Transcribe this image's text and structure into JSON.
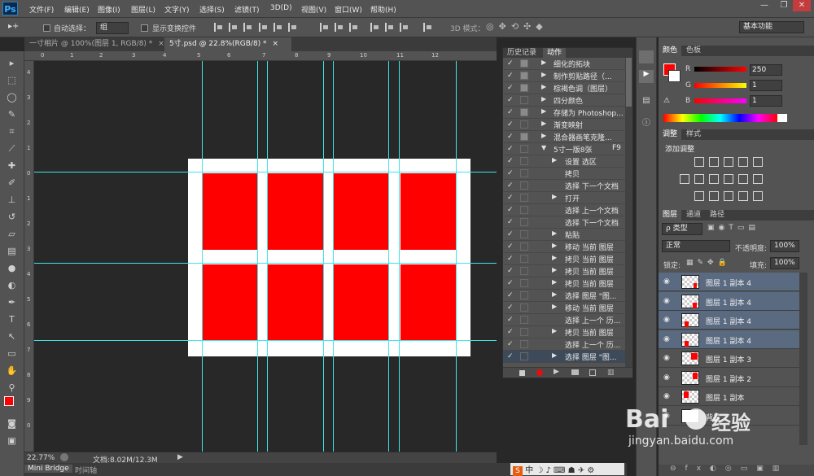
{
  "app": {
    "logo": "Ps",
    "menus": [
      "文件(F)",
      "编辑(E)",
      "图像(I)",
      "图层(L)",
      "文字(Y)",
      "选择(S)",
      "滤镜(T)",
      "3D(D)",
      "视图(V)",
      "窗口(W)",
      "帮助(H)"
    ],
    "win_min": "—",
    "win_max": "❐",
    "win_close": "✕"
  },
  "options": {
    "auto_select_label": "自动选择：",
    "auto_select_value": "组",
    "show_transform_label": "显示变换控件",
    "mode_3d_label": "3D 模式：",
    "workspace": "基本功能"
  },
  "tabs": [
    {
      "label": "一寸相片 @ 100%(图层 1, RGB/8) *",
      "close": "×"
    },
    {
      "label": "5寸.psd @ 22.8%(RGB/8) *",
      "close": "×"
    }
  ],
  "ruler_top": [
    "0",
    "1",
    "2",
    "3",
    "4",
    "5",
    "6",
    "7",
    "8",
    "9",
    "10",
    "11",
    "12"
  ],
  "ruler_left": [
    "4",
    "3",
    "2",
    "1",
    "0",
    "1",
    "2",
    "3",
    "4",
    "5",
    "6",
    "7",
    "8",
    "9",
    "0"
  ],
  "status": {
    "zoom": "22.77%",
    "doc": "文档:8.02M/12.3M"
  },
  "bottom_tabs": [
    "Mini Bridge",
    "时间轴"
  ],
  "actions_panel": {
    "tabs": [
      "历史记录",
      "动作"
    ],
    "rows": [
      {
        "check": "✓",
        "box": true,
        "arrow": "▶",
        "indent": 0,
        "label": "细化的拓块",
        "sel": false
      },
      {
        "check": "✓",
        "box": true,
        "arrow": "▶",
        "indent": 0,
        "label": "制作剪贴路径（...",
        "sel": false
      },
      {
        "check": "✓",
        "box": true,
        "arrow": "▶",
        "indent": 0,
        "label": "棕褐色调（图层）",
        "sel": false
      },
      {
        "check": "✓",
        "box": false,
        "arrow": "▶",
        "indent": 0,
        "label": "四分颜色",
        "sel": false
      },
      {
        "check": "✓",
        "box": true,
        "arrow": "▶",
        "indent": 0,
        "label": "存储为 Photoshop...",
        "sel": false
      },
      {
        "check": "✓",
        "box": false,
        "arrow": "▶",
        "indent": 0,
        "label": "渐变映射",
        "sel": false
      },
      {
        "check": "✓",
        "box": true,
        "arrow": "▶",
        "indent": 0,
        "label": "混合器画笔克隆...",
        "sel": false
      },
      {
        "check": "✓",
        "box": false,
        "arrow": "▼",
        "indent": 0,
        "label": "5寸一版8张",
        "shortcut": "F9",
        "sel": false
      },
      {
        "check": "✓",
        "box": false,
        "arrow": "▶",
        "indent": 1,
        "label": "设置 选区",
        "sel": false
      },
      {
        "check": "✓",
        "box": false,
        "arrow": "",
        "indent": 1,
        "label": "拷贝",
        "sel": false
      },
      {
        "check": "✓",
        "box": false,
        "arrow": "",
        "indent": 1,
        "label": "选择 下一个文档",
        "sel": false
      },
      {
        "check": "✓",
        "box": false,
        "arrow": "▶",
        "indent": 1,
        "label": "打开",
        "sel": false
      },
      {
        "check": "✓",
        "box": false,
        "arrow": "",
        "indent": 1,
        "label": "选择 上一个文档",
        "sel": false
      },
      {
        "check": "✓",
        "box": false,
        "arrow": "",
        "indent": 1,
        "label": "选择 下一个文档",
        "sel": false
      },
      {
        "check": "✓",
        "box": false,
        "arrow": "▶",
        "indent": 1,
        "label": "粘贴",
        "sel": false
      },
      {
        "check": "✓",
        "box": false,
        "arrow": "▶",
        "indent": 1,
        "label": "移动 当前 图层",
        "sel": false
      },
      {
        "check": "✓",
        "box": false,
        "arrow": "▶",
        "indent": 1,
        "label": "拷贝 当前 图层",
        "sel": false
      },
      {
        "check": "✓",
        "box": false,
        "arrow": "▶",
        "indent": 1,
        "label": "拷贝 当前 图层",
        "sel": false
      },
      {
        "check": "✓",
        "box": false,
        "arrow": "▶",
        "indent": 1,
        "label": "拷贝 当前 图层",
        "sel": false
      },
      {
        "check": "✓",
        "box": false,
        "arrow": "▶",
        "indent": 1,
        "label": "选择 图层 \"图...",
        "sel": false
      },
      {
        "check": "✓",
        "box": false,
        "arrow": "▶",
        "indent": 1,
        "label": "移动 当前 图层",
        "sel": false
      },
      {
        "check": "✓",
        "box": false,
        "arrow": "",
        "indent": 1,
        "label": "选择 上一个 历...",
        "sel": false
      },
      {
        "check": "✓",
        "box": false,
        "arrow": "▶",
        "indent": 1,
        "label": "拷贝 当前 图层",
        "sel": false
      },
      {
        "check": "✓",
        "box": false,
        "arrow": "",
        "indent": 1,
        "label": "选择 上一个 历...",
        "sel": false
      },
      {
        "check": "✓",
        "box": false,
        "arrow": "▶",
        "indent": 1,
        "label": "选择 图层 \"图...",
        "sel": true
      }
    ]
  },
  "color_panel": {
    "tabs": [
      "颜色",
      "色板"
    ],
    "r_label": "R",
    "g_label": "G",
    "b_label": "B",
    "r": "250",
    "g": "1",
    "b": "1",
    "fg_color": "#fa0101"
  },
  "adjust_panel": {
    "tabs": [
      "调整",
      "样式"
    ],
    "title": "添加调整"
  },
  "layers_panel": {
    "tabs": [
      "图层",
      "通道",
      "路径"
    ],
    "filter": "ρ 类型",
    "blend": "正常",
    "opacity_label": "不透明度:",
    "opacity": "100%",
    "lock_label": "锁定:",
    "fill_label": "填充:",
    "fill": "100%",
    "eye": "👁",
    "layers": [
      {
        "name": "图层 1 副本 4",
        "sel": true
      },
      {
        "name": "图层 1 副本 4",
        "sel": true
      },
      {
        "name": "图层 1 副本 4",
        "sel": true
      },
      {
        "name": "图层 1 副本 4",
        "sel": true
      },
      {
        "name": "图层 1 副本 3",
        "sel": false
      },
      {
        "name": "图层 1 副本 2",
        "sel": false
      },
      {
        "name": "图层 1 副本",
        "sel": false
      },
      {
        "name": "背景",
        "sel": false
      }
    ]
  },
  "watermark": {
    "text": "Bai",
    "text2": "经验",
    "url": "jingyan.baidu.com"
  }
}
